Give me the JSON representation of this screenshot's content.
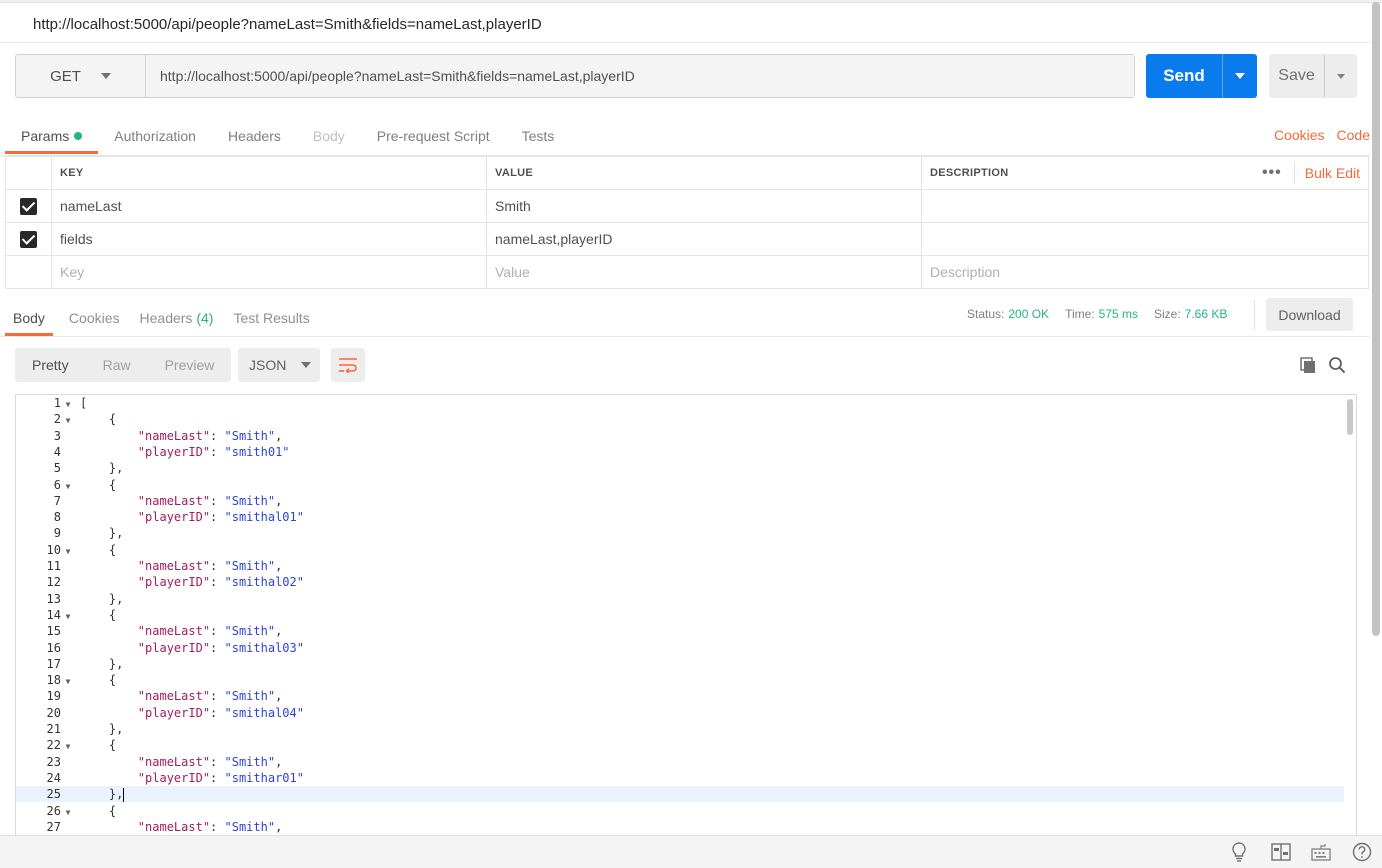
{
  "request": {
    "title": "http://localhost:5000/api/people?nameLast=Smith&fields=nameLast,playerID",
    "method": "GET",
    "url": "http://localhost:5000/api/people?nameLast=Smith&fields=nameLast,playerID",
    "send_label": "Send",
    "save_label": "Save"
  },
  "request_tabs": [
    {
      "label": "Params",
      "active": true,
      "dot": true
    },
    {
      "label": "Authorization"
    },
    {
      "label": "Headers"
    },
    {
      "label": "Body",
      "disabled": true
    },
    {
      "label": "Pre-request Script"
    },
    {
      "label": "Tests"
    }
  ],
  "right_links": {
    "cookies": "Cookies",
    "code": "Code"
  },
  "params": {
    "headers": {
      "key": "KEY",
      "value": "VALUE",
      "description": "DESCRIPTION",
      "more": "•••",
      "bulk_edit": "Bulk Edit"
    },
    "rows": [
      {
        "checked": true,
        "key": "nameLast",
        "value": "Smith",
        "description": ""
      },
      {
        "checked": true,
        "key": "fields",
        "value": "nameLast,playerID",
        "description": ""
      }
    ],
    "placeholders": {
      "key": "Key",
      "value": "Value",
      "description": "Description"
    }
  },
  "response_tabs": {
    "body": "Body",
    "cookies": "Cookies",
    "headers": "Headers",
    "headers_count": "(4)",
    "test_results": "Test Results"
  },
  "response_meta": {
    "status_label": "Status:",
    "status": "200 OK",
    "time_label": "Time:",
    "time": "575 ms",
    "size_label": "Size:",
    "size": "7.66 KB",
    "download": "Download"
  },
  "format": {
    "pretty": "Pretty",
    "raw": "Raw",
    "preview": "Preview",
    "language": "JSON"
  },
  "code_lines": [
    {
      "n": "1",
      "fold": true,
      "indent": "",
      "text": "["
    },
    {
      "n": "2",
      "fold": true,
      "indent": "    ",
      "text": "{"
    },
    {
      "n": "3",
      "indent": "        ",
      "key": "\"nameLast\"",
      "sep": ": ",
      "val": "\"Smith\"",
      "tail": ","
    },
    {
      "n": "4",
      "indent": "        ",
      "key": "\"playerID\"",
      "sep": ": ",
      "val": "\"smith01\"",
      "tail": ""
    },
    {
      "n": "5",
      "indent": "    ",
      "text": "},"
    },
    {
      "n": "6",
      "fold": true,
      "indent": "    ",
      "text": "{"
    },
    {
      "n": "7",
      "indent": "        ",
      "key": "\"nameLast\"",
      "sep": ": ",
      "val": "\"Smith\"",
      "tail": ","
    },
    {
      "n": "8",
      "indent": "        ",
      "key": "\"playerID\"",
      "sep": ": ",
      "val": "\"smithal01\"",
      "tail": ""
    },
    {
      "n": "9",
      "indent": "    ",
      "text": "},"
    },
    {
      "n": "10",
      "fold": true,
      "indent": "    ",
      "text": "{"
    },
    {
      "n": "11",
      "indent": "        ",
      "key": "\"nameLast\"",
      "sep": ": ",
      "val": "\"Smith\"",
      "tail": ","
    },
    {
      "n": "12",
      "indent": "        ",
      "key": "\"playerID\"",
      "sep": ": ",
      "val": "\"smithal02\"",
      "tail": ""
    },
    {
      "n": "13",
      "indent": "    ",
      "text": "},"
    },
    {
      "n": "14",
      "fold": true,
      "indent": "    ",
      "text": "{"
    },
    {
      "n": "15",
      "indent": "        ",
      "key": "\"nameLast\"",
      "sep": ": ",
      "val": "\"Smith\"",
      "tail": ","
    },
    {
      "n": "16",
      "indent": "        ",
      "key": "\"playerID\"",
      "sep": ": ",
      "val": "\"smithal03\"",
      "tail": ""
    },
    {
      "n": "17",
      "indent": "    ",
      "text": "},"
    },
    {
      "n": "18",
      "fold": true,
      "indent": "    ",
      "text": "{"
    },
    {
      "n": "19",
      "indent": "        ",
      "key": "\"nameLast\"",
      "sep": ": ",
      "val": "\"Smith\"",
      "tail": ","
    },
    {
      "n": "20",
      "indent": "        ",
      "key": "\"playerID\"",
      "sep": ": ",
      "val": "\"smithal04\"",
      "tail": ""
    },
    {
      "n": "21",
      "indent": "    ",
      "text": "},"
    },
    {
      "n": "22",
      "fold": true,
      "indent": "    ",
      "text": "{"
    },
    {
      "n": "23",
      "indent": "        ",
      "key": "\"nameLast\"",
      "sep": ": ",
      "val": "\"Smith\"",
      "tail": ","
    },
    {
      "n": "24",
      "indent": "        ",
      "key": "\"playerID\"",
      "sep": ": ",
      "val": "\"smithar01\"",
      "tail": ""
    },
    {
      "n": "25",
      "indent": "    ",
      "text": "},",
      "highlight": true,
      "cursor": true
    },
    {
      "n": "26",
      "fold": true,
      "indent": "    ",
      "text": "{"
    },
    {
      "n": "27",
      "indent": "        ",
      "key": "\"nameLast\"",
      "sep": ": ",
      "val": "\"Smith\"",
      "tail": ","
    }
  ],
  "colors": {
    "accent": "#f26b3a",
    "send": "#097bed",
    "success": "#26b47f",
    "json_key": "#a11d5e",
    "json_string": "#2c44d8"
  },
  "icons": {
    "copy": "copy-icon",
    "search": "search-icon",
    "wrap": "wrap-lines-icon",
    "statusbar": [
      "bulb-icon",
      "two-pane-icon",
      "keyboard-icon",
      "help-icon"
    ]
  }
}
